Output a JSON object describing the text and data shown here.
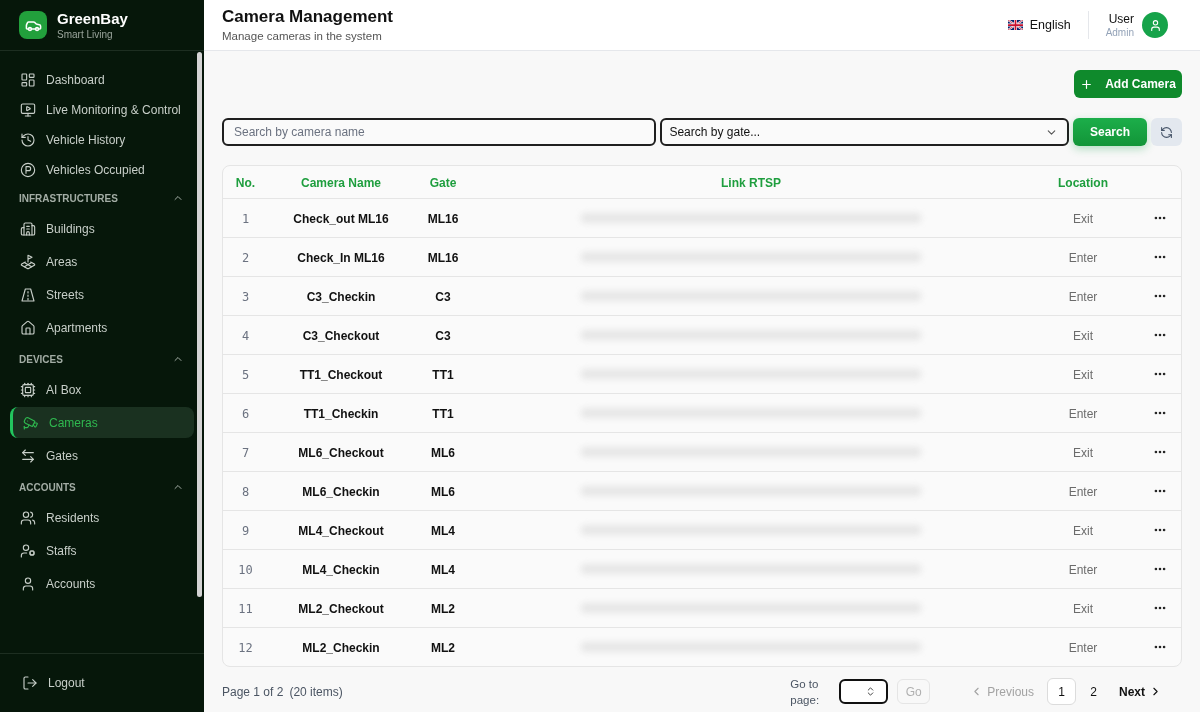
{
  "sidebar": {
    "brand": {
      "name": "GreenBay",
      "tagline": "Smart Living"
    },
    "groups": [
      {
        "items": [
          {
            "label": "Dashboard",
            "selected": false
          },
          {
            "label": "Live Monitoring & Control",
            "selected": false
          },
          {
            "label": "Vehicle History",
            "selected": false
          },
          {
            "label": "Vehicles Occupied",
            "selected": false
          }
        ]
      },
      {
        "title": "INFRASTRUCTURES",
        "expanded": true,
        "items": [
          {
            "label": "Buildings",
            "selected": false
          },
          {
            "label": "Areas",
            "selected": false
          },
          {
            "label": "Streets",
            "selected": false
          },
          {
            "label": "Apartments",
            "selected": false
          }
        ]
      },
      {
        "title": "DEVICES",
        "expanded": true,
        "items": [
          {
            "label": "AI Box",
            "selected": false
          },
          {
            "label": "Cameras",
            "selected": true
          },
          {
            "label": "Gates",
            "selected": false
          }
        ]
      },
      {
        "title": "ACCOUNTS",
        "expanded": true,
        "items": [
          {
            "label": "Residents",
            "selected": false
          },
          {
            "label": "Staffs",
            "selected": false
          },
          {
            "label": "Accounts",
            "selected": false
          }
        ]
      }
    ],
    "logout": "Logout"
  },
  "header": {
    "title": "Camera Management",
    "subtitle": "Manage cameras in the system",
    "language": "English",
    "user": {
      "name": "User",
      "role": "Admin"
    }
  },
  "toolbar": {
    "add_button": "Add Camera",
    "search": {
      "placeholder": "Search by camera name"
    },
    "gate_select": {
      "placeholder": "Search by gate..."
    },
    "search_button": "Search"
  },
  "table": {
    "columns": [
      "No.",
      "Camera Name",
      "Gate",
      "Link RTSP",
      "Location"
    ],
    "rows": [
      {
        "no": "1",
        "camera_name": "Check_out ML16",
        "gate": "ML16",
        "location": "Exit"
      },
      {
        "no": "2",
        "camera_name": "Check_In ML16",
        "gate": "ML16",
        "location": "Enter"
      },
      {
        "no": "3",
        "camera_name": "C3_Checkin",
        "gate": "C3",
        "location": "Enter"
      },
      {
        "no": "4",
        "camera_name": "C3_Checkout",
        "gate": "C3",
        "location": "Exit"
      },
      {
        "no": "5",
        "camera_name": "TT1_Checkout",
        "gate": "TT1",
        "location": "Exit"
      },
      {
        "no": "6",
        "camera_name": "TT1_Checkin",
        "gate": "TT1",
        "location": "Enter"
      },
      {
        "no": "7",
        "camera_name": "ML6_Checkout",
        "gate": "ML6",
        "location": "Exit"
      },
      {
        "no": "8",
        "camera_name": "ML6_Checkin",
        "gate": "ML6",
        "location": "Enter"
      },
      {
        "no": "9",
        "camera_name": "ML4_Checkout",
        "gate": "ML4",
        "location": "Exit"
      },
      {
        "no": "10",
        "camera_name": "ML4_Checkin",
        "gate": "ML4",
        "location": "Enter"
      },
      {
        "no": "11",
        "camera_name": "ML2_Checkout",
        "gate": "ML2",
        "location": "Exit"
      },
      {
        "no": "12",
        "camera_name": "ML2_Checkin",
        "gate": "ML2",
        "location": "Enter"
      }
    ]
  },
  "pagination": {
    "page_info": "Page 1 of 2",
    "item_count": "(20 items)",
    "go_to_label": "Go to page:",
    "go_button": {
      "label": "Go",
      "disabled": true
    },
    "previous": {
      "label": "Previous",
      "disabled": true
    },
    "pages": [
      {
        "label": "1",
        "selected": true
      },
      {
        "label": "2",
        "selected": false
      }
    ],
    "next": {
      "label": "Next",
      "disabled": false
    }
  }
}
